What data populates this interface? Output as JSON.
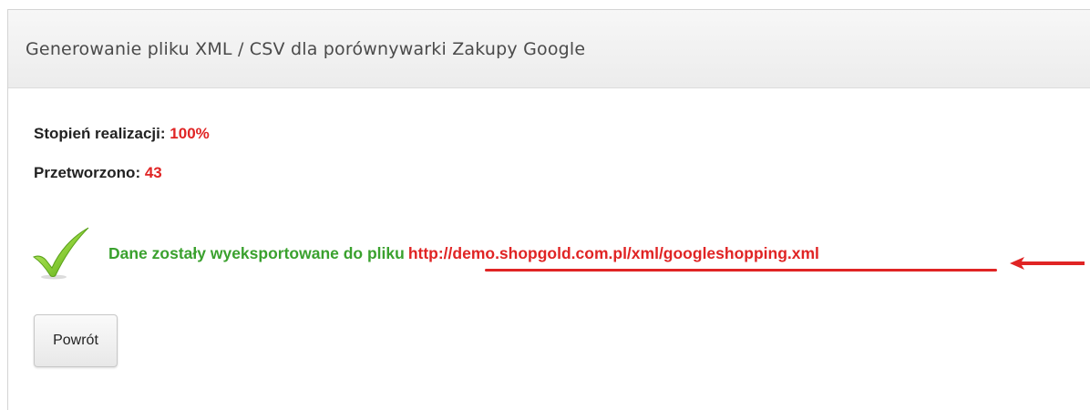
{
  "panel": {
    "title": "Generowanie pliku XML / CSV dla porównywarki Zakupy Google"
  },
  "stats": {
    "progress_label": "Stopień realizacji:",
    "progress_value": "100%",
    "processed_label": "Przetworzono:",
    "processed_value": "43"
  },
  "export": {
    "message": "Dane zostały wyeksportowane do pliku",
    "link_text": "http://demo.shopgold.com.pl/xml/googleshopping.xml",
    "success_icon": "checkmark-icon",
    "annotation_icon": "arrow-left-icon"
  },
  "actions": {
    "back_label": "Powrót"
  },
  "colors": {
    "accent_red": "#e02424",
    "success_green": "#3aa12e"
  }
}
